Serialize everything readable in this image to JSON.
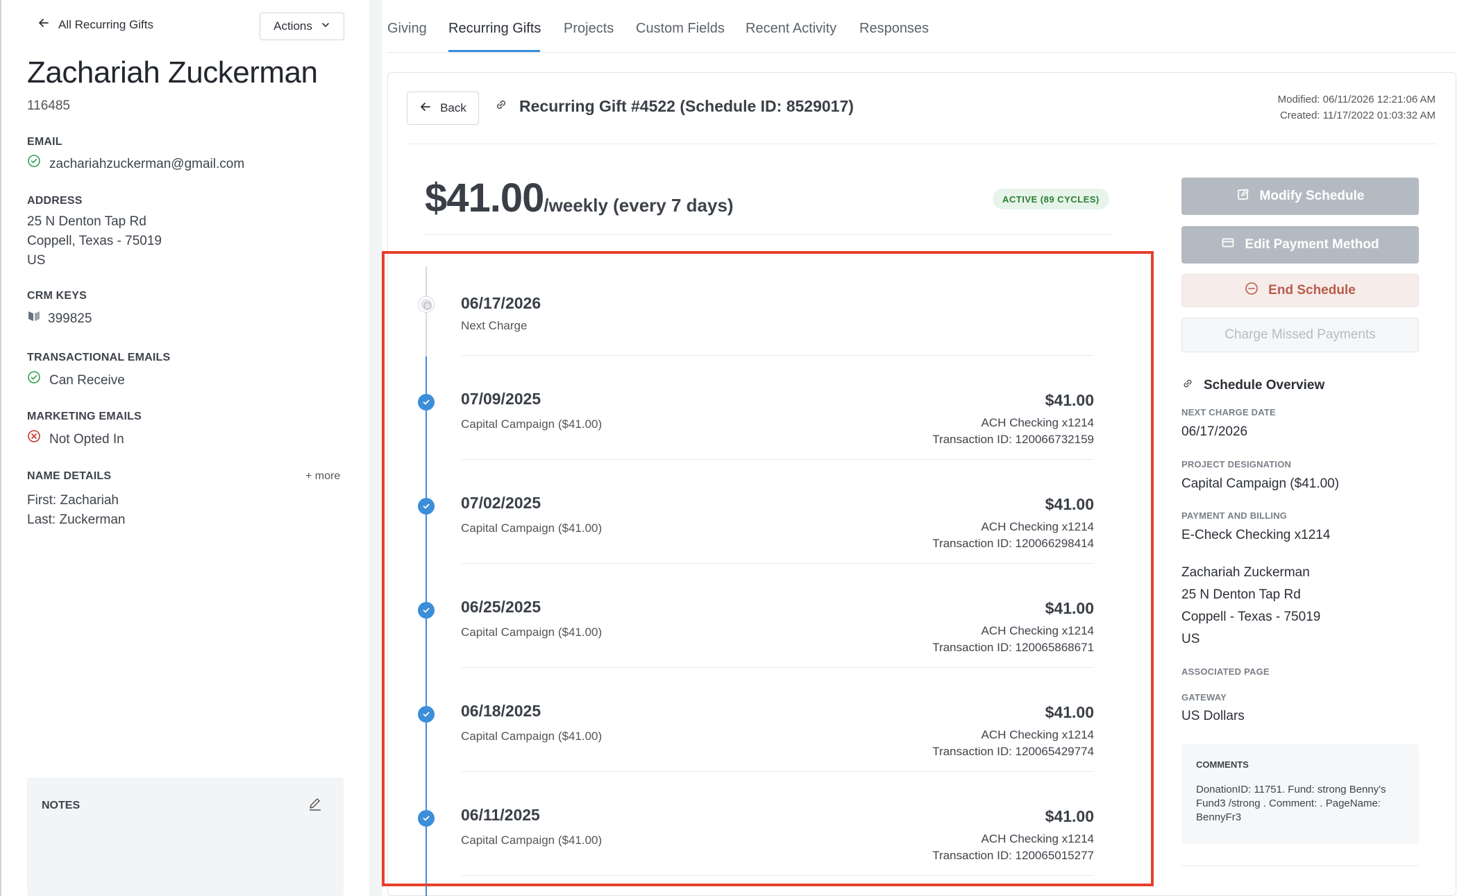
{
  "left": {
    "back_link": "All Recurring Gifts",
    "actions_label": "Actions",
    "donor_name": "Zachariah Zuckerman",
    "donor_id": "116485",
    "email_label": "EMAIL",
    "email": "zachariahzuckerman@gmail.com",
    "address_label": "ADDRESS",
    "address_line1": "25 N Denton Tap Rd",
    "address_line2": "Coppell, Texas - 75019",
    "address_line3": "US",
    "crm_label": "CRM KEYS",
    "crm_value": "399825",
    "trans_label": "TRANSACTIONAL EMAILS",
    "trans_value": "Can Receive",
    "mkt_label": "MARKETING EMAILS",
    "mkt_value": "Not Opted In",
    "name_details_label": "NAME DETAILS",
    "more_label": "+ more",
    "first_name": "First: Zachariah",
    "last_name": "Last: Zuckerman",
    "notes_label": "NOTES"
  },
  "tabs": [
    "Giving",
    "Recurring Gifts",
    "Projects",
    "Custom Fields",
    "Recent Activity",
    "Responses"
  ],
  "active_tab": "Recurring Gifts",
  "gift": {
    "back_label": "Back",
    "title": "Recurring Gift #4522 (Schedule ID: 8529017)",
    "modified": "Modified: 06/11/2026 12:21:06 AM",
    "created": "Created: 11/17/2022 01:03:32 AM",
    "amount": "$41.00",
    "frequency": "/weekly (every 7 days)",
    "status_badge": "ACTIVE (89 CYCLES)"
  },
  "timeline": {
    "next_date": "06/17/2026",
    "next_label": "Next Charge",
    "entries": [
      {
        "date": "07/09/2025",
        "desc": "Capital Campaign ($41.00)",
        "amount": "$41.00",
        "method": "ACH Checking x1214",
        "txn": "Transaction ID: 120066732159"
      },
      {
        "date": "07/02/2025",
        "desc": "Capital Campaign ($41.00)",
        "amount": "$41.00",
        "method": "ACH Checking x1214",
        "txn": "Transaction ID: 120066298414"
      },
      {
        "date": "06/25/2025",
        "desc": "Capital Campaign ($41.00)",
        "amount": "$41.00",
        "method": "ACH Checking x1214",
        "txn": "Transaction ID: 120065868671"
      },
      {
        "date": "06/18/2025",
        "desc": "Capital Campaign ($41.00)",
        "amount": "$41.00",
        "method": "ACH Checking x1214",
        "txn": "Transaction ID: 120065429774"
      },
      {
        "date": "06/11/2025",
        "desc": "Capital Campaign ($41.00)",
        "amount": "$41.00",
        "method": "ACH Checking x1214",
        "txn": "Transaction ID: 120065015277"
      }
    ]
  },
  "sidebar": {
    "modify": "Modify Schedule",
    "edit_payment": "Edit Payment Method",
    "end": "End Schedule",
    "charge_missed": "Charge Missed Payments",
    "overview_title": "Schedule Overview",
    "next_charge_label": "NEXT CHARGE DATE",
    "next_charge_value": "06/17/2026",
    "project_label": "PROJECT DESIGNATION",
    "project_value": "Capital Campaign ($41.00)",
    "payment_label": "PAYMENT AND BILLING",
    "payment_value": "E-Check Checking x1214",
    "billing_name": "Zachariah Zuckerman",
    "billing_line1": "25 N Denton Tap Rd",
    "billing_line2": "Coppell - Texas - 75019",
    "billing_line3": "US",
    "associated_label": "ASSOCIATED PAGE",
    "gateway_label": "GATEWAY",
    "gateway_value": "US Dollars",
    "comments_label": "COMMENTS",
    "comments_text": "DonationID: 11751. Fund: strong Benny's Fund3 /strong . Comment: . PageName: BennyFr3"
  },
  "colors": {
    "accent": "#3b8fd9",
    "highlight": "#e5412d",
    "success": "#2e9e4f",
    "danger": "#c0392b"
  }
}
